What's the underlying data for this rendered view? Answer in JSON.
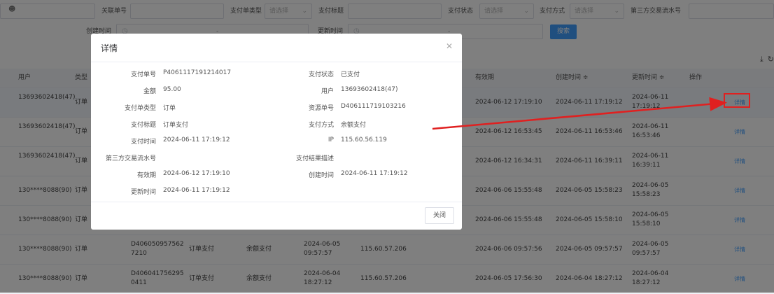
{
  "filters": {
    "row1": {
      "user_icon": "user-icon",
      "related_no_label": "关联单号",
      "pay_doc_type_label": "支付单类型",
      "pay_doc_type_placeholder": "请选择",
      "pay_title_label": "支付标题",
      "pay_status_label": "支付状态",
      "pay_status_placeholder": "请选择",
      "pay_method_label": "支付方式",
      "pay_method_placeholder": "请选择",
      "third_party_label": "第三方交易流水号"
    },
    "row2": {
      "created_label": "创建时间",
      "updated_label": "更新时间",
      "range_sep": "-",
      "search_label": "搜索"
    }
  },
  "toolbar": {
    "download_icon": "download-icon",
    "refresh_icon": "refresh-icon"
  },
  "table": {
    "headers": {
      "user": "用户",
      "type": "类型",
      "expire": "有效期",
      "created": "创建时间 ≑",
      "updated": "更新时间 ≑",
      "action": "操作"
    },
    "rows": [
      {
        "user": "13693602418(47)",
        "type": "订单",
        "expire": "2024-06-12 17:19:10",
        "created": "2024-06-11 17:19:12",
        "updated": "2024-06-11 17:19:12",
        "action": "详情"
      },
      {
        "user": "13693602418(47)",
        "type": "订单",
        "expire": "2024-06-12 16:53:45",
        "created": "2024-06-11 16:53:46",
        "updated": "2024-06-11 16:53:46",
        "action": "详情"
      },
      {
        "user": "13693602418(47)",
        "type": "订单",
        "expire": "2024-06-12 16:34:31",
        "created": "2024-06-11 16:39:11",
        "updated": "2024-06-11 16:39:11",
        "action": "详情"
      },
      {
        "user": "130****8088(90)",
        "type": "订单",
        "expire": "2024-06-06 15:55:48",
        "created": "2024-06-05 15:58:23",
        "updated": "2024-06-05 15:58:23",
        "action": "详情"
      },
      {
        "user": "130****8088(90)",
        "type": "订单",
        "expire": "2024-06-06 15:55:48",
        "created": "2024-06-05 15:58:10",
        "updated": "2024-06-05 15:58:10",
        "action": "详情"
      },
      {
        "user": "130****8088(90)",
        "type": "订单",
        "resource_no": "D4060509575627210",
        "pay_title": "订单支付",
        "pay_method": "余额支付",
        "pay_time": "2024-06-05 09:57:57",
        "ip": "115.60.57.206",
        "expire": "2024-06-06 09:57:56",
        "created": "2024-06-05 09:57:57",
        "updated": "2024-06-05 09:57:57",
        "action": "详情"
      },
      {
        "user": "130****8088(90)",
        "type": "订单",
        "resource_no": "D4060417562950411",
        "pay_title": "订单支付",
        "pay_method": "余额支付",
        "pay_time": "2024-06-04 18:27:12",
        "ip": "115.60.57.206",
        "expire": "2024-06-05 17:56:30",
        "created": "2024-06-04 18:27:12",
        "updated": "2024-06-04 18:27:12",
        "action": "详情"
      }
    ]
  },
  "modal": {
    "title": "详情",
    "close_icon": "close-icon",
    "left": [
      {
        "label": "支付单号",
        "value": "P4061117191214017"
      },
      {
        "label": "金额",
        "value": "95.00"
      },
      {
        "label": "支付单类型",
        "value": "订单"
      },
      {
        "label": "支付标题",
        "value": "订单支付"
      },
      {
        "label": "支付时间",
        "value": "2024-06-11 17:19:12"
      },
      {
        "label": "第三方交易流水号",
        "value": ""
      },
      {
        "label": "有效期",
        "value": "2024-06-12 17:19:10"
      },
      {
        "label": "更新时间",
        "value": "2024-06-11 17:19:12"
      }
    ],
    "right": [
      {
        "label": "支付状态",
        "value": "已支付"
      },
      {
        "label": "用户",
        "value": "13693602418(47)"
      },
      {
        "label": "资源单号",
        "value": "D406111719103216"
      },
      {
        "label": "支付方式",
        "value": "余额支付"
      },
      {
        "label": "IP",
        "value": "115.60.56.119"
      },
      {
        "label": "支付结果描述",
        "value": ""
      },
      {
        "label": "创建时间",
        "value": "2024-06-11 17:19:12"
      }
    ],
    "close_button": "关闭"
  },
  "colors": {
    "accent": "#409eff",
    "annotation": "#e02020",
    "overlay": "rgba(0,0,0,0.5)"
  }
}
